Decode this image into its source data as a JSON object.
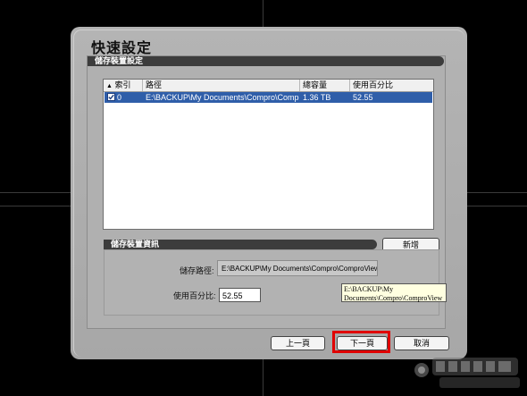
{
  "dialog": {
    "title": "快速設定",
    "section_storage_settings": "儲存裝置設定",
    "section_storage_info": "儲存裝置資訊"
  },
  "list": {
    "columns": [
      "索引",
      "路徑",
      "總容量",
      "使用百分比"
    ],
    "rows": [
      {
        "checked": true,
        "index": "0",
        "path": "E:\\BACKUP\\My Documents\\Compro\\ComproVi...",
        "capacity": "1.36 TB",
        "usage": "52.55"
      }
    ]
  },
  "info": {
    "add_button": "新增",
    "path_label": "儲存路徑:",
    "path_value": "E:\\BACKUP\\My Documents\\Compro\\ComproView",
    "usage_label": "使用百分比:",
    "usage_value": "52.55",
    "tooltip_line1": "E:\\BACKUP\\My",
    "tooltip_line2": "Documents\\Compro\\ComproView"
  },
  "buttons": {
    "prev": "上一頁",
    "next": "下一頁",
    "cancel": "取消"
  },
  "colors": {
    "selection": "#2f5ea9",
    "highlight": "#e00000",
    "section_bar": "#3c3c3c"
  }
}
